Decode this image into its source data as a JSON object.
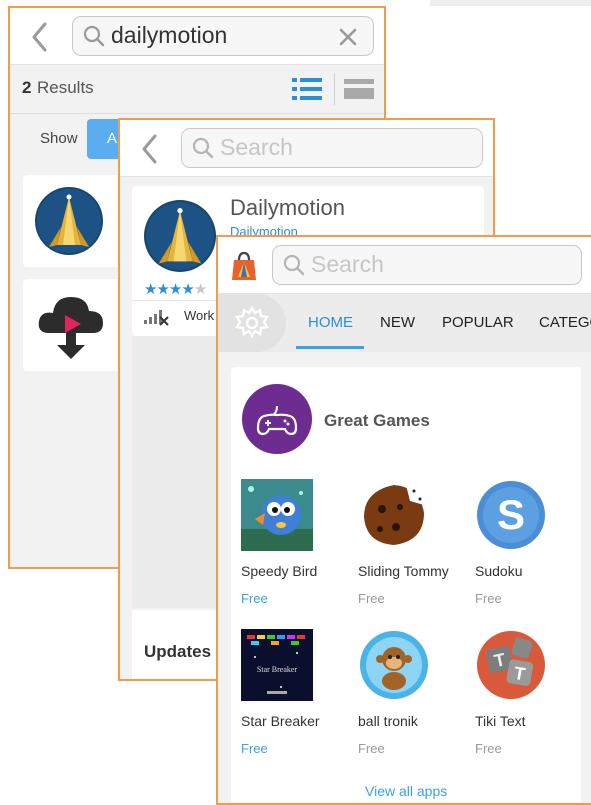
{
  "colors": {
    "accent": "#f09b4d",
    "link": "#3aa3e0",
    "tab_underline": "#3aa3e0",
    "games_purple": "#6d2c8f"
  },
  "screen_search_results": {
    "search_value": "dailymotion",
    "results_count": "2",
    "results_label": "Results",
    "show_label": "Show",
    "filter_all": "All",
    "icons": [
      "back-icon",
      "search-icon",
      "clear-icon",
      "list-view-icon",
      "grid-view-icon"
    ],
    "results": [
      {
        "icon": "dailymotion-app-icon"
      },
      {
        "icon": "cloud-download-app-icon"
      }
    ]
  },
  "screen_app_detail": {
    "search_placeholder": "Search",
    "app_name": "Dailymotion",
    "app_developer": "Dailymotion",
    "rating_stars": 4,
    "rating_max": 5,
    "compat_text": "Work",
    "updates_label": "Updates"
  },
  "screen_home": {
    "search_placeholder": "Search",
    "tabs": [
      {
        "label": "HOME",
        "active": true
      },
      {
        "label": "NEW",
        "active": false
      },
      {
        "label": "POPULAR",
        "active": false
      },
      {
        "label": "CATEGO",
        "active": false
      }
    ],
    "section_title": "Great Games",
    "apps": [
      {
        "name": "Speedy Bird",
        "price": "Free",
        "price_highlight": true,
        "icon": "speedy-bird-icon"
      },
      {
        "name": "Sliding Tommy",
        "price": "Free",
        "price_highlight": false,
        "icon": "sliding-tommy-icon"
      },
      {
        "name": "Sudoku",
        "price": "Free",
        "price_highlight": false,
        "icon": "sudoku-icon"
      },
      {
        "name": "Star Breaker",
        "price": "Free",
        "price_highlight": true,
        "icon": "star-breaker-icon"
      },
      {
        "name": "ball tronik",
        "price": "Free",
        "price_highlight": false,
        "icon": "ball-tronik-icon"
      },
      {
        "name": "Tiki Text",
        "price": "Free",
        "price_highlight": false,
        "icon": "tiki-text-icon"
      }
    ],
    "view_all_label": "View all apps",
    "star_breaker_icon_text": "Star Breaker"
  }
}
